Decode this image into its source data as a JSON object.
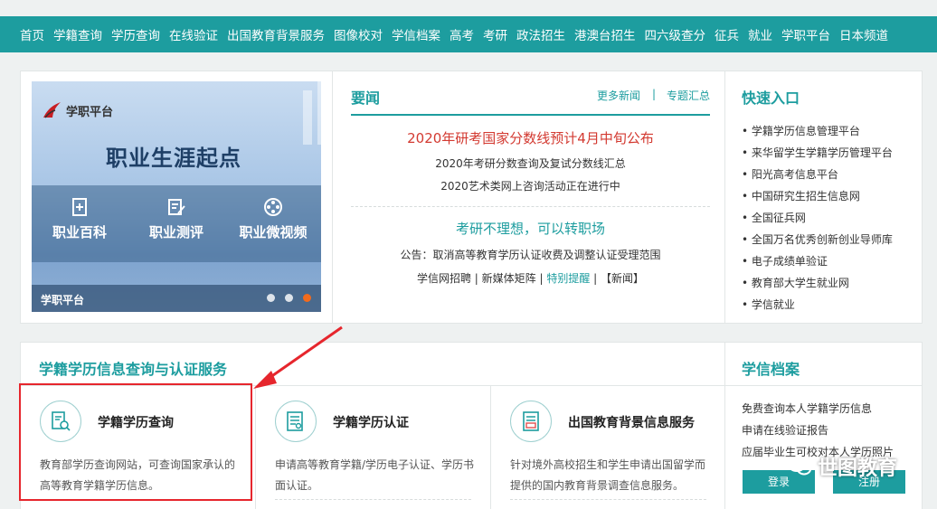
{
  "nav": [
    "首页",
    "学籍查询",
    "学历查询",
    "在线验证",
    "出国教育背景服务",
    "图像校对",
    "学信档案",
    "高考",
    "考研",
    "政法招生",
    "港澳台招生",
    "四六级查分",
    "征兵",
    "就业",
    "学职平台",
    "日本频道"
  ],
  "banner": {
    "logo_text": "学职平台",
    "slogan": "职业生涯起点",
    "tools": [
      "职业百科",
      "职业测评",
      "职业微视频"
    ],
    "footer": "学职平台",
    "active_dot": 3
  },
  "news": {
    "title": "要闻",
    "more": "更多新闻",
    "separator": "|",
    "topics": "专题汇总",
    "headline1": "2020年研考国家分数线预计4月中旬公布",
    "items1": [
      "2020年考研分数查询及复试分数线汇总",
      "2020艺术类网上咨询活动正在进行中"
    ],
    "headline2": "考研不理想，可以转职场",
    "notice": "公告：取消高等教育学历认证收费及调整认证受理范围",
    "links": {
      "a": "学信网招聘",
      "sep1": " | ",
      "b": "新媒体矩阵",
      "sep2": " | ",
      "c": "特别提醒",
      "sep3": " | ",
      "d": "【新闻】"
    }
  },
  "quick": {
    "title": "快速入口",
    "items": [
      "学籍学历信息管理平台",
      "来华留学生学籍学历管理平台",
      "阳光高考信息平台",
      "中国研究生招生信息网",
      "全国征兵网",
      "全国万名优秀创新创业导师库",
      "电子成绩单验证",
      "教育部大学生就业网",
      "学信就业"
    ]
  },
  "services": {
    "title": "学籍学历信息查询与认证服务",
    "items": [
      {
        "name": "学籍学历查询",
        "desc": "教育部学历查询网站，可查询国家承认的高等教育学籍学历信息。"
      },
      {
        "name": "学籍学历认证",
        "desc": "申请高等教育学籍/学历电子认证、学历书面认证。"
      },
      {
        "name": "出国教育背景信息服务",
        "desc": "针对境外高校招生和学生申请出国留学而提供的国内教育背景调查信息服务。"
      }
    ]
  },
  "archive": {
    "title": "学信档案",
    "lines": [
      "免费查询本人学籍学历信息",
      "申请在线验证报告",
      "应届毕业生可校对本人学历照片"
    ],
    "login": "登录",
    "register": "注册"
  },
  "watermark": "世图教育",
  "colors": {
    "accent": "#1d9d9f",
    "headline_red": "#d33a31",
    "highlight": "#e6262d"
  }
}
